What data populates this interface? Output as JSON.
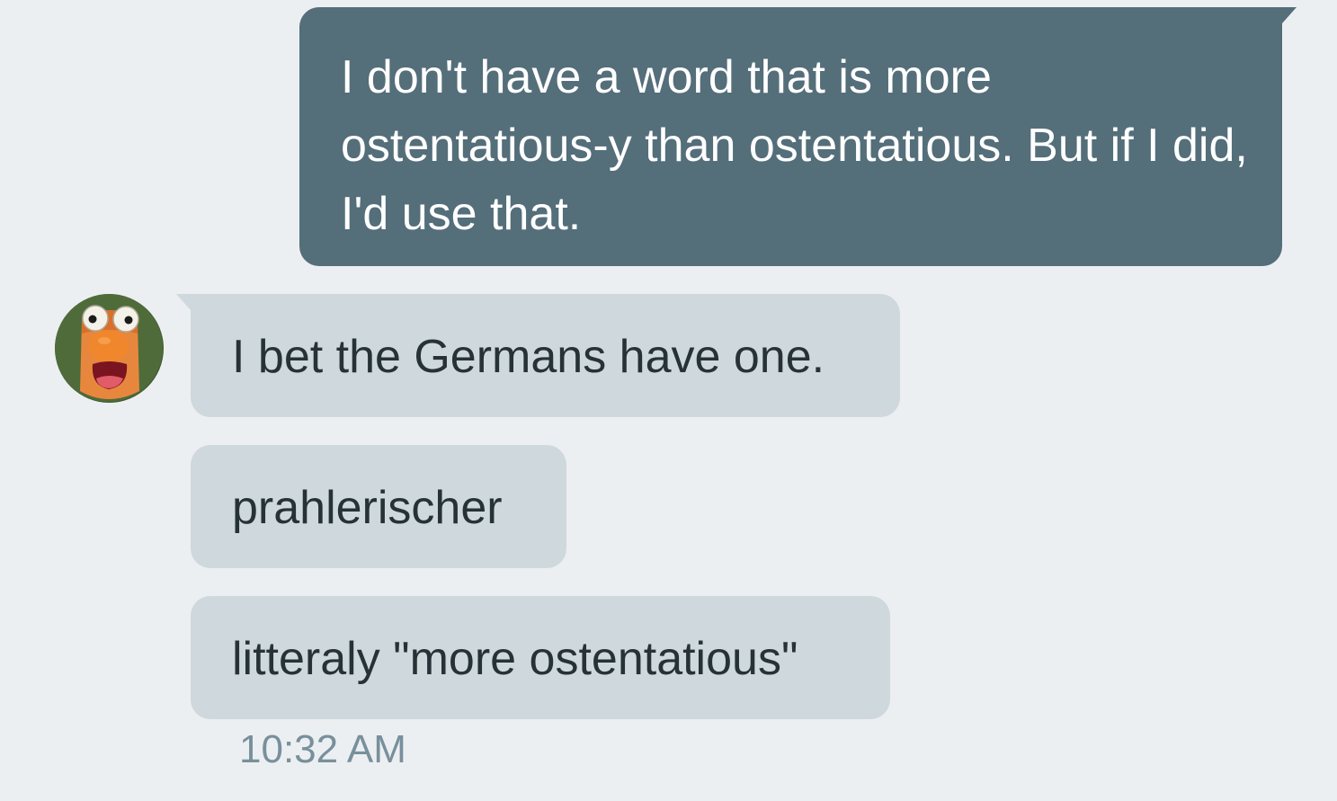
{
  "conversation": {
    "outgoing": [
      {
        "text": "I don't have a word that is more ostentatious-y than ostentatious. But if I did, I'd use that."
      }
    ],
    "incoming": [
      {
        "text": "I bet the Germans have one."
      },
      {
        "text": "prahlerischer"
      },
      {
        "text": "litteraly \"more ostentatious\""
      }
    ],
    "timestamp": "10:32 AM"
  },
  "colors": {
    "background": "#eceff1",
    "outgoing_bubble": "#546e7a",
    "incoming_bubble": "#cfd8dc",
    "incoming_text": "#263238",
    "timestamp_text": "#78909c"
  },
  "icons": {
    "avatar": "muppet-avatar"
  }
}
